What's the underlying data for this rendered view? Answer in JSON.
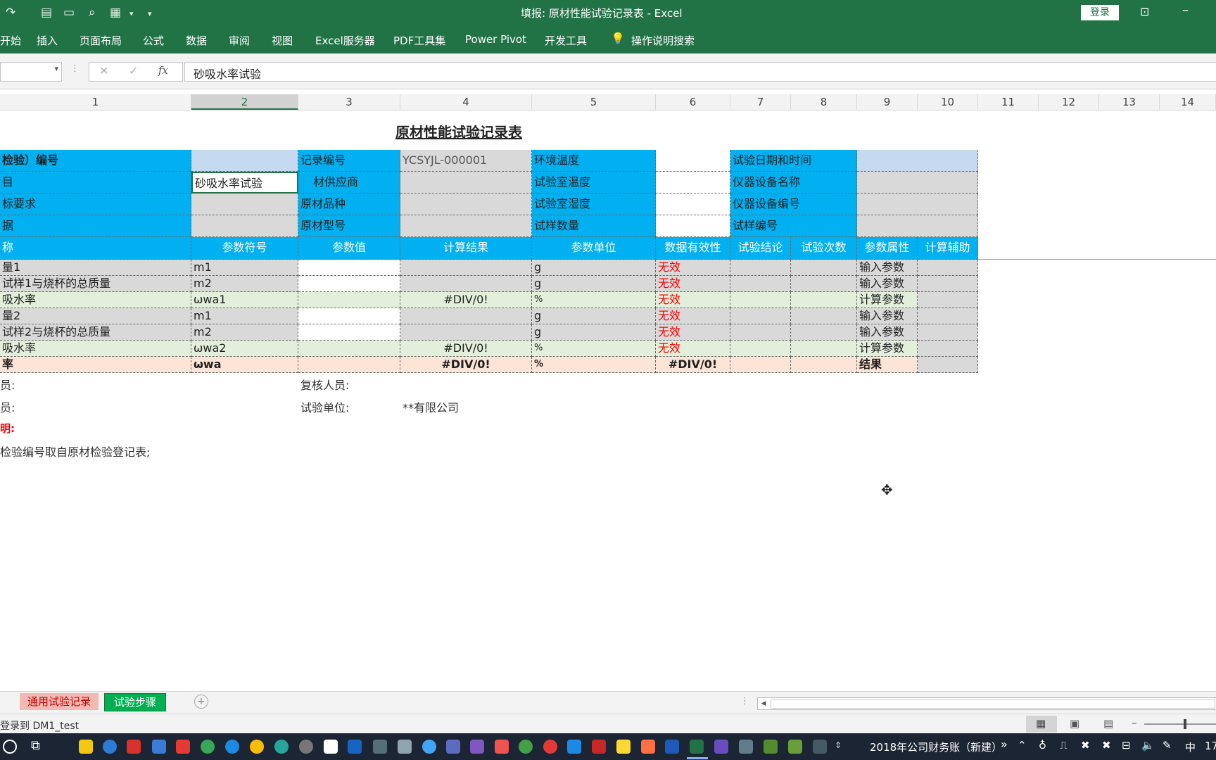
{
  "window": {
    "title": "填报: 原材性能试验记录表  -  Excel",
    "login_label": "登录"
  },
  "ribbon": {
    "tabs": [
      "开始",
      "插入",
      "页面布局",
      "公式",
      "数据",
      "审阅",
      "视图",
      "Excel服务器",
      "PDF工具集",
      "Power Pivot",
      "开发工具",
      "操作说明搜索"
    ]
  },
  "formula_bar": {
    "cancel_glyph": "✕",
    "enter_glyph": "✓",
    "fx_label": "fx",
    "value": "砂吸水率试验"
  },
  "columns": [
    "1",
    "2",
    "3",
    "4",
    "5",
    "6",
    "7",
    "8",
    "9",
    "10",
    "11",
    "12",
    "13",
    "14"
  ],
  "sheet": {
    "title": "原材性能试验记录表",
    "info_rows": [
      {
        "c1": "检验）编号",
        "c2": "",
        "c3": "记录编号",
        "c4": "YCSYJL-000001",
        "c5": "环境温度",
        "c6": "",
        "c7": "试验日期和时间",
        "c9": ""
      },
      {
        "c1": "目",
        "c2": "砂吸水率试验",
        "c3": "材供应商",
        "c4": "",
        "c5": "试验室温度",
        "c6": "",
        "c7": "仪器设备名称",
        "c9": ""
      },
      {
        "c1": "标要求",
        "c2": "",
        "c3": "原材品种",
        "c4": "",
        "c5": "试验室湿度",
        "c6": "",
        "c7": "仪器设备编号",
        "c9": ""
      },
      {
        "c1": "据",
        "c2": "",
        "c3": "原材型号",
        "c4": "",
        "c5": "试样数量",
        "c6": "",
        "c7": "试样编号",
        "c9": ""
      }
    ],
    "param_headers": [
      "称",
      "参数符号",
      "参数值",
      "计算结果",
      "参数单位",
      "数据有效性",
      "试验结论",
      "试验次数",
      "参数属性",
      "计算辅助"
    ],
    "param_rows": [
      {
        "name": "量1",
        "symbol": "m1",
        "value": "",
        "result": "",
        "unit": "g",
        "validity": "无效",
        "attr": "输入参数",
        "kind": "input"
      },
      {
        "name": "试样1与烧杯的总质量",
        "symbol": "m2",
        "value": "",
        "result": "",
        "unit": "g",
        "validity": "无效",
        "attr": "输入参数",
        "kind": "input"
      },
      {
        "name": "吸水率",
        "symbol": "ωwa1",
        "value": "",
        "result": "#DIV/0!",
        "unit": "%",
        "validity": "无效",
        "attr": "计算参数",
        "kind": "calc"
      },
      {
        "name": "量2",
        "symbol": "m1",
        "value": "",
        "result": "",
        "unit": "g",
        "validity": "无效",
        "attr": "输入参数",
        "kind": "input"
      },
      {
        "name": "试样2与烧杯的总质量",
        "symbol": "m2",
        "value": "",
        "result": "",
        "unit": "g",
        "validity": "无效",
        "attr": "输入参数",
        "kind": "input"
      },
      {
        "name": "吸水率",
        "symbol": "ωwa2",
        "value": "",
        "result": "#DIV/0!",
        "unit": "%",
        "validity": "无效",
        "attr": "计算参数",
        "kind": "calc"
      },
      {
        "name": "率",
        "symbol": "ωwa",
        "value": "",
        "result": "#DIV/0!",
        "unit": "%",
        "validity": "#DIV/0!",
        "attr": "结果",
        "kind": "result"
      }
    ],
    "footer": {
      "tester_label": "员:",
      "reviewer_label": "复核人员:",
      "recorder_label": "员:",
      "unit_label": "试验单位:",
      "unit_value": "**有限公司",
      "note_title": "明:",
      "note_line": "检验编号取自原材检验登记表;"
    }
  },
  "sheet_tabs": [
    "通用试验记录",
    "试验步骤"
  ],
  "status": {
    "text": "登录到 DM1_test"
  },
  "taskbar": {
    "window_label": "2018年公司财务账（新建）",
    "ime": "中",
    "clock": "17"
  },
  "colors": {
    "excel_green": "#217346",
    "header_blue": "#00b0f0",
    "light_blue": "#c5d9f1",
    "gray_cell": "#d9d9d9",
    "calc_green": "#e2efda",
    "result_peach": "#fce4d6",
    "invalid_red": "#ff0000"
  }
}
